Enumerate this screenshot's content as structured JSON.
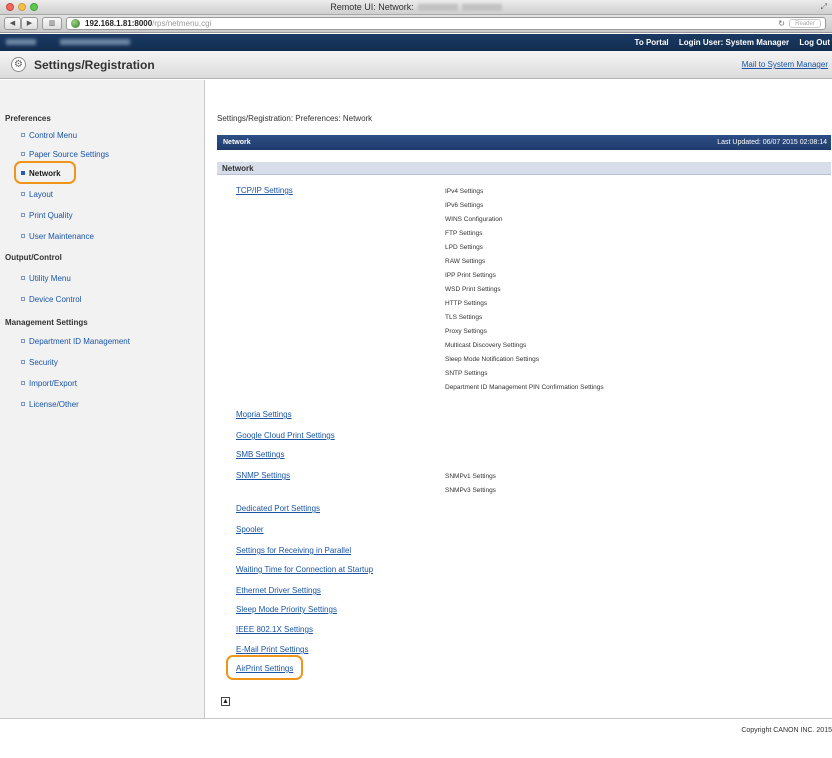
{
  "window": {
    "title": "Remote UI: Network:"
  },
  "browser": {
    "url_host": "192.168.1.81:8000",
    "url_path": "/rps/netmenu.cgi",
    "reader_label": "Reader"
  },
  "portal_bar": {
    "to_portal": "To Portal",
    "login_user": "Login User: System Manager",
    "logout": "Log Out"
  },
  "header": {
    "title": "Settings/Registration",
    "mail": "Mail to System Manager"
  },
  "sidebar": {
    "preferences": {
      "title": "Preferences",
      "items": [
        {
          "label": "Control Menu"
        },
        {
          "label": "Paper Source Settings"
        },
        {
          "label": "Network"
        },
        {
          "label": "Layout"
        },
        {
          "label": "Print Quality"
        },
        {
          "label": "User Maintenance"
        }
      ]
    },
    "output_control": {
      "title": "Output/Control",
      "items": [
        {
          "label": "Utility Menu"
        },
        {
          "label": "Device Control"
        }
      ]
    },
    "management": {
      "title": "Management Settings",
      "items": [
        {
          "label": "Department ID Management"
        },
        {
          "label": "Security"
        },
        {
          "label": "Import/Export"
        },
        {
          "label": "License/Other"
        }
      ]
    }
  },
  "main": {
    "breadcrumb": "Settings/Registration: Preferences: Network",
    "section_bar": {
      "title": "Network",
      "updated": "Last Updated: 06/07 2015 02:08:14"
    },
    "subsection_title": "Network",
    "tcpip": {
      "label": "TCP/IP Settings",
      "subitems": [
        "IPv4 Settings",
        "IPv6 Settings",
        "WINS Configuration",
        "FTP Settings",
        "LPD Settings",
        "RAW Settings",
        "IPP Print Settings",
        "WSD Print Settings",
        "HTTP Settings",
        "TLS Settings",
        "Proxy Settings",
        "Multicast Discovery Settings",
        "Sleep Mode Notification Settings",
        "SNTP Settings",
        "Department ID Management PIN Confirmation Settings"
      ]
    },
    "links_a": [
      "Mopria Settings",
      "Google Cloud Print Settings",
      "SMB Settings"
    ],
    "snmp": {
      "label": "SNMP Settings",
      "subitems": [
        "SNMPv1 Settings",
        "SNMPv3 Settings"
      ]
    },
    "links_b": [
      "Dedicated Port Settings",
      "Spooler",
      "Settings for Receiving in Parallel",
      "Waiting Time for Connection at Startup",
      "Ethernet Driver Settings",
      "Sleep Mode Priority Settings",
      "IEEE 802.1X Settings",
      "E-Mail Print Settings",
      "AirPrint Settings"
    ]
  },
  "footer": {
    "copyright": "Copyright CANON INC. 2015"
  },
  "colors": {
    "highlight_ring": "#f0951c",
    "link": "#1a55a5",
    "section_bar": "#1e3b6b"
  }
}
